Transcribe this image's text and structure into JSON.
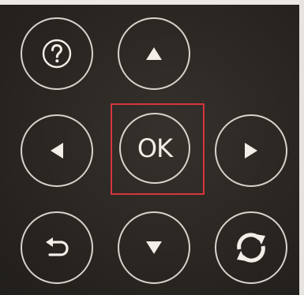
{
  "remote": {
    "buttons": {
      "help": {
        "icon": "question-mark-icon"
      },
      "up": {
        "icon": "triangle-up-icon"
      },
      "left": {
        "icon": "triangle-left-icon"
      },
      "ok": {
        "label": "OK"
      },
      "right": {
        "icon": "triangle-right-icon"
      },
      "back": {
        "icon": "back-arrow-icon"
      },
      "down": {
        "icon": "triangle-down-icon"
      },
      "refresh": {
        "icon": "refresh-icon"
      }
    },
    "selected": "ok"
  },
  "colors": {
    "panel": "#2b2824",
    "ring": "#d8d4cd",
    "glyph": "#f2efe9",
    "highlight": "#d9343d"
  }
}
